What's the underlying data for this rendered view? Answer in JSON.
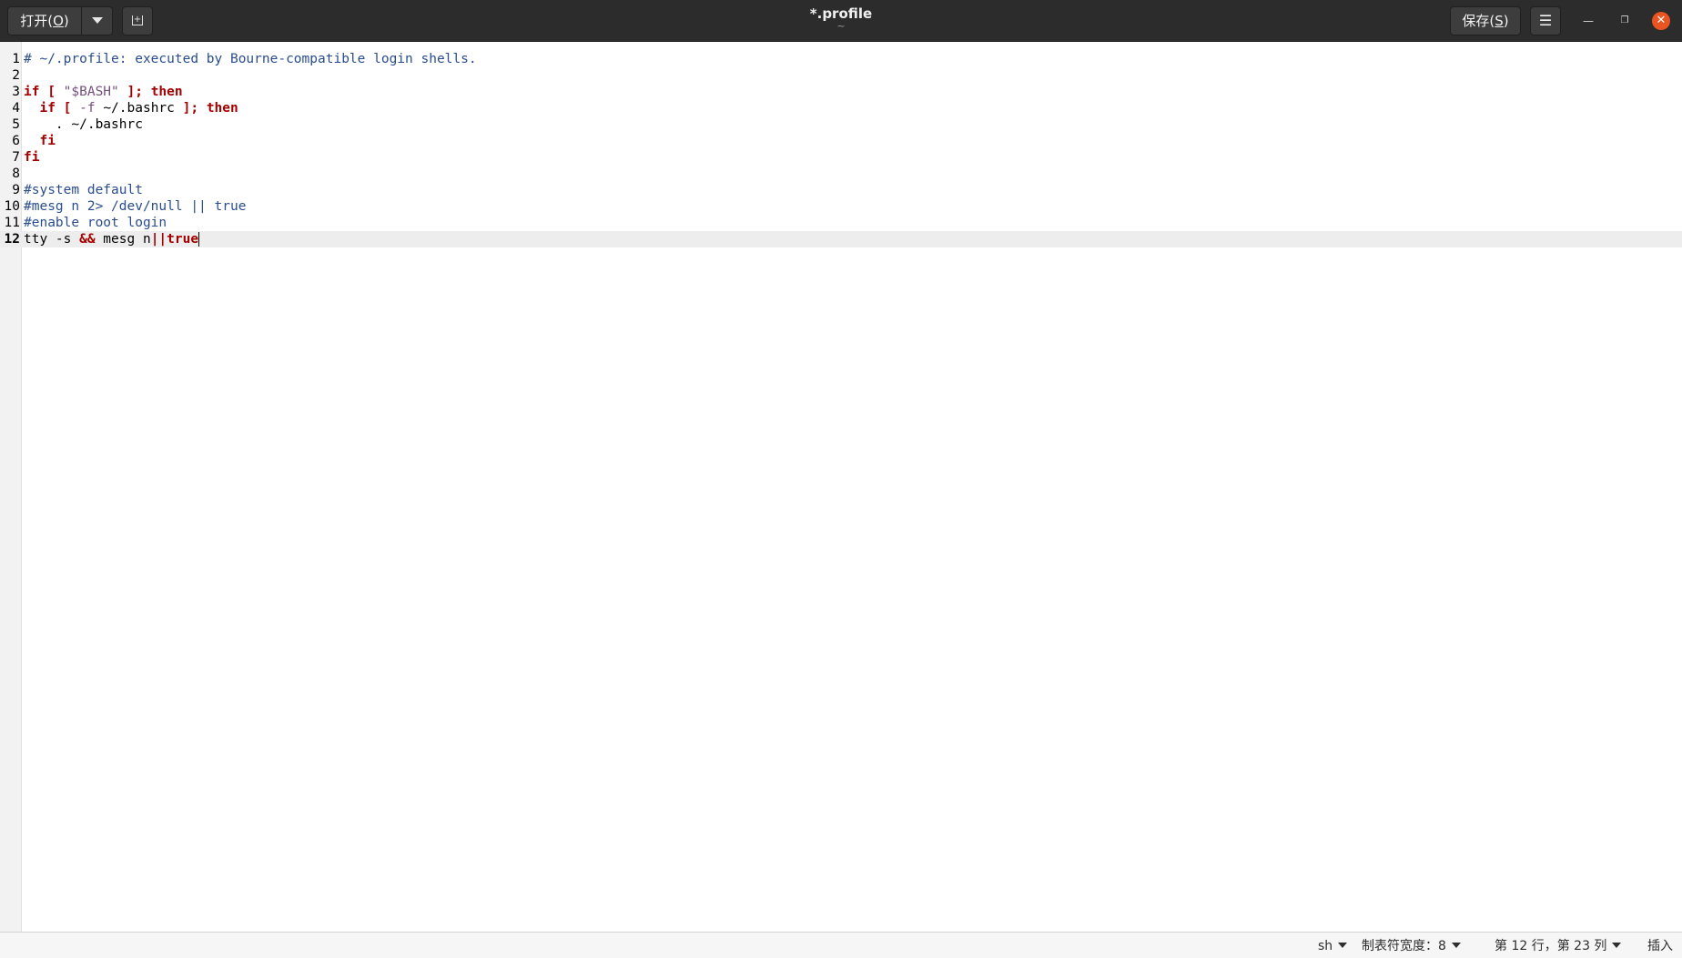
{
  "header": {
    "open_label": "打开(",
    "open_mnemonic": "O",
    "open_label_end": ")",
    "save_label": "保存(",
    "save_mnemonic": "S",
    "save_label_end": ")",
    "title": "*.profile",
    "subtitle": "~",
    "menu_icon": "hamburger-icon",
    "minimize_icon": "minimize-icon",
    "maximize_icon": "maximize-icon",
    "close_icon": "close-icon",
    "close_color": "#e95420"
  },
  "editor": {
    "current_line": 12,
    "lines": [
      {
        "n": "1",
        "segs": [
          [
            "cmt",
            "# ~/.profile: executed by Bourne-compatible login shells."
          ]
        ]
      },
      {
        "n": "2",
        "segs": []
      },
      {
        "n": "3",
        "segs": [
          [
            "kw",
            "if ["
          ],
          [
            "",
            " "
          ],
          [
            "str",
            "\"$BASH\""
          ],
          [
            "",
            " "
          ],
          [
            "kw",
            "]; then"
          ]
        ]
      },
      {
        "n": "4",
        "segs": [
          [
            "",
            "  "
          ],
          [
            "kw",
            "if ["
          ],
          [
            "",
            " "
          ],
          [
            "str",
            "-f"
          ],
          [
            "",
            " ~/.bashrc "
          ],
          [
            "kw",
            "]; then"
          ]
        ]
      },
      {
        "n": "5",
        "segs": [
          [
            "",
            "    . ~/.bashrc"
          ]
        ]
      },
      {
        "n": "6",
        "segs": [
          [
            "",
            "  "
          ],
          [
            "kw",
            "fi"
          ]
        ]
      },
      {
        "n": "7",
        "segs": [
          [
            "kw",
            "fi"
          ]
        ]
      },
      {
        "n": "8",
        "segs": []
      },
      {
        "n": "9",
        "segs": [
          [
            "cmt",
            "#system default"
          ]
        ]
      },
      {
        "n": "10",
        "segs": [
          [
            "cmt",
            "#mesg n 2> /dev/null || true"
          ]
        ]
      },
      {
        "n": "11",
        "segs": [
          [
            "cmt",
            "#enable root login"
          ]
        ]
      },
      {
        "n": "12",
        "segs": [
          [
            "",
            "tty -s "
          ],
          [
            "kw",
            "&&"
          ],
          [
            "",
            " mesg n"
          ],
          [
            "kw",
            "||true"
          ]
        ]
      }
    ]
  },
  "statusbar": {
    "language": "sh",
    "tab_width": "制表符宽度：8",
    "position": "第 12 行，第 23 列",
    "mode": "插入"
  }
}
